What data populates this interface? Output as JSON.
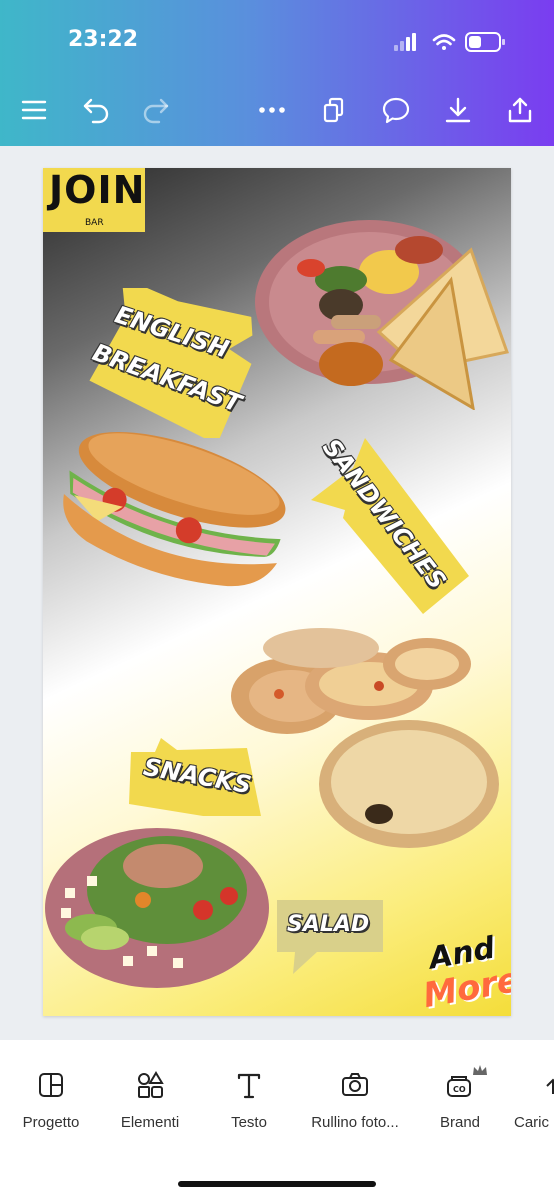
{
  "status_bar": {
    "time": "23:22"
  },
  "toolbar": {
    "icons": [
      "menu-icon",
      "undo-icon",
      "redo-icon",
      "more-icon",
      "duplicate-pages-icon",
      "comment-icon",
      "download-icon",
      "share-icon"
    ]
  },
  "poster": {
    "logo": {
      "main": "JOIN",
      "sub": "BAR"
    },
    "labels": {
      "breakfast_line1": "ENGLISH",
      "breakfast_line2": "BREAKFAST",
      "sandwiches": "SANDWICHES",
      "snacks": "SNACKS",
      "salad": "SALAD",
      "and": "And",
      "more": "More"
    },
    "colors": {
      "label_bg": "#f2d94e",
      "salad_bg": "#d9d08a",
      "more": "#ff6a3d"
    }
  },
  "bottom_tools": [
    {
      "label": "Progetto",
      "icon": "layout-icon"
    },
    {
      "label": "Elementi",
      "icon": "shapes-icon"
    },
    {
      "label": "Testo",
      "icon": "text-icon"
    },
    {
      "label": "Rullino foto...",
      "icon": "camera-icon"
    },
    {
      "label": "Brand",
      "icon": "brand-icon"
    },
    {
      "label": "Caric",
      "icon": "upload-icon"
    }
  ]
}
